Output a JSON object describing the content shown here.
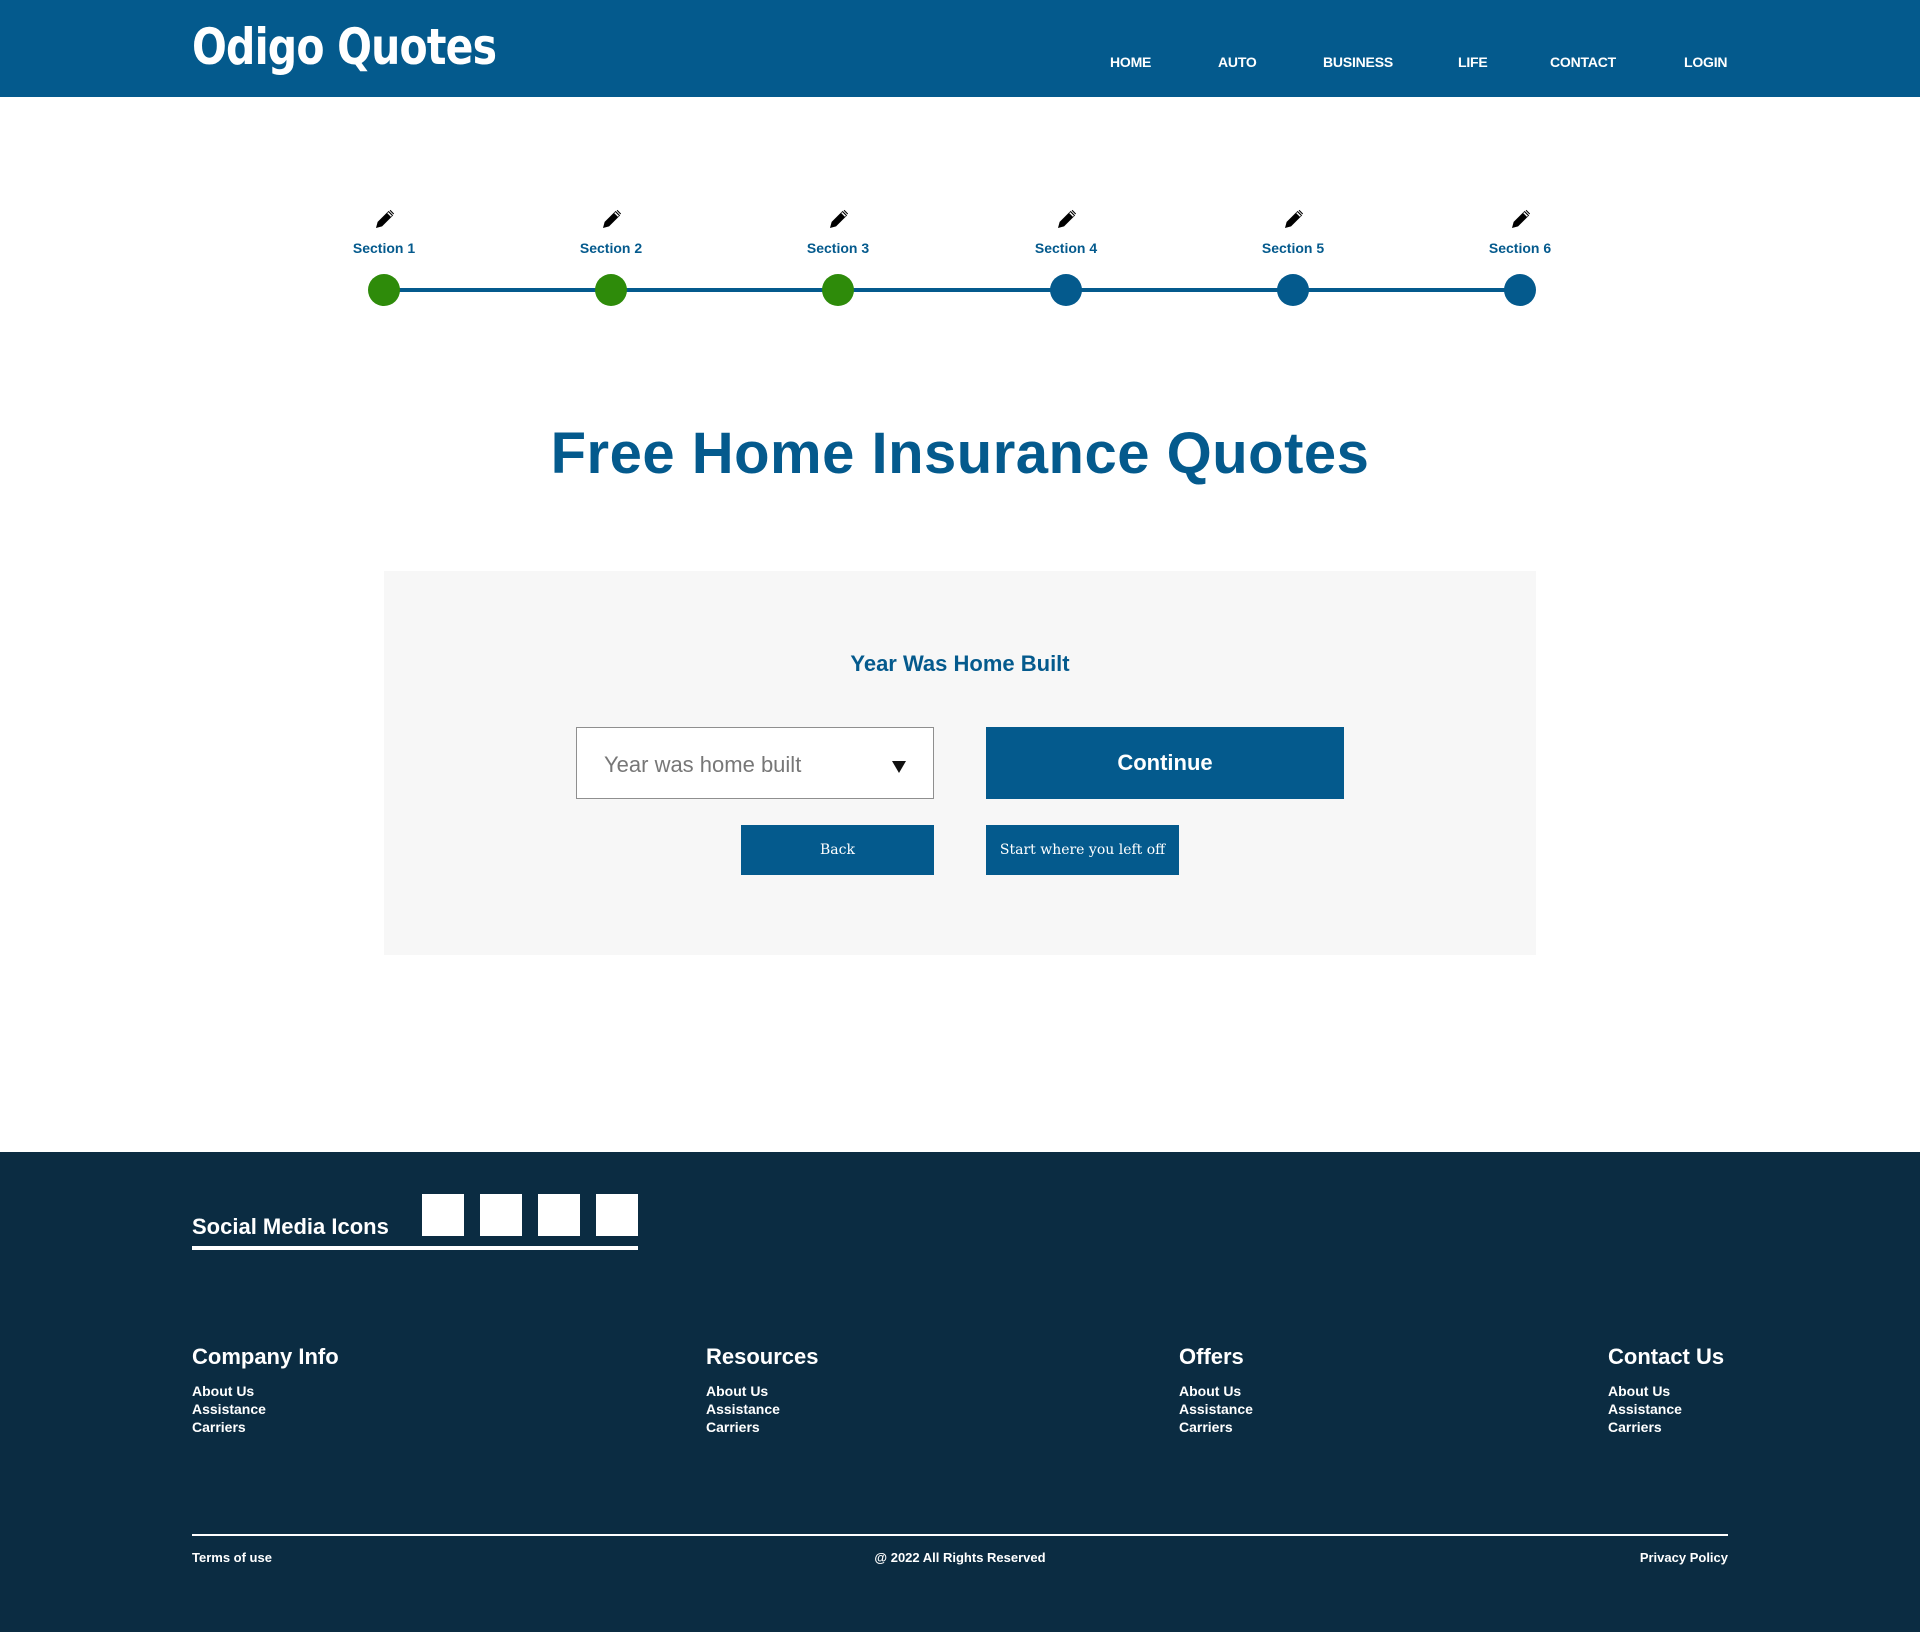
{
  "colors": {
    "brand_blue": "#045A8D",
    "complete_green": "#2E8B0A",
    "footer_navy": "#0B2C42",
    "card_bg": "#F7F7F7"
  },
  "header": {
    "logo": "Odigo Quotes",
    "nav": [
      "HOME",
      "AUTO",
      "BUSINESS",
      "LIFE",
      "CONTACT",
      "LOGIN"
    ]
  },
  "progress": {
    "steps": [
      {
        "label": "Section 1",
        "status": "complete",
        "icon": "pencil-icon"
      },
      {
        "label": "Section 2",
        "status": "complete",
        "icon": "pencil-icon"
      },
      {
        "label": "Section 3",
        "status": "complete",
        "icon": "pencil-icon"
      },
      {
        "label": "Section 4",
        "status": "incomplete",
        "icon": "pencil-icon"
      },
      {
        "label": "Section 5",
        "status": "incomplete",
        "icon": "pencil-icon"
      },
      {
        "label": "Section 6",
        "status": "incomplete",
        "icon": "pencil-icon"
      }
    ]
  },
  "main": {
    "title": "Free Home Insurance Quotes",
    "form": {
      "question": "Year Was Home Built",
      "select_placeholder": "Year was home built",
      "continue_label": "Continue",
      "back_label": "Back",
      "resume_label": "Start where you left off"
    }
  },
  "footer": {
    "social_title": "Social Media Icons",
    "columns": [
      {
        "title": "Company Info",
        "links": [
          "About Us",
          "Assistance",
          "Carriers"
        ]
      },
      {
        "title": "Resources",
        "links": [
          "About Us",
          "Assistance",
          "Carriers"
        ]
      },
      {
        "title": "Offers",
        "links": [
          "About Us",
          "Assistance",
          "Carriers"
        ]
      },
      {
        "title": "Contact Us",
        "links": [
          "About Us",
          "Assistance",
          "Carriers"
        ]
      }
    ],
    "terms": "Terms of use",
    "copyright": "@ 2022 All Rights Reserved",
    "privacy": "Privacy Policy"
  }
}
